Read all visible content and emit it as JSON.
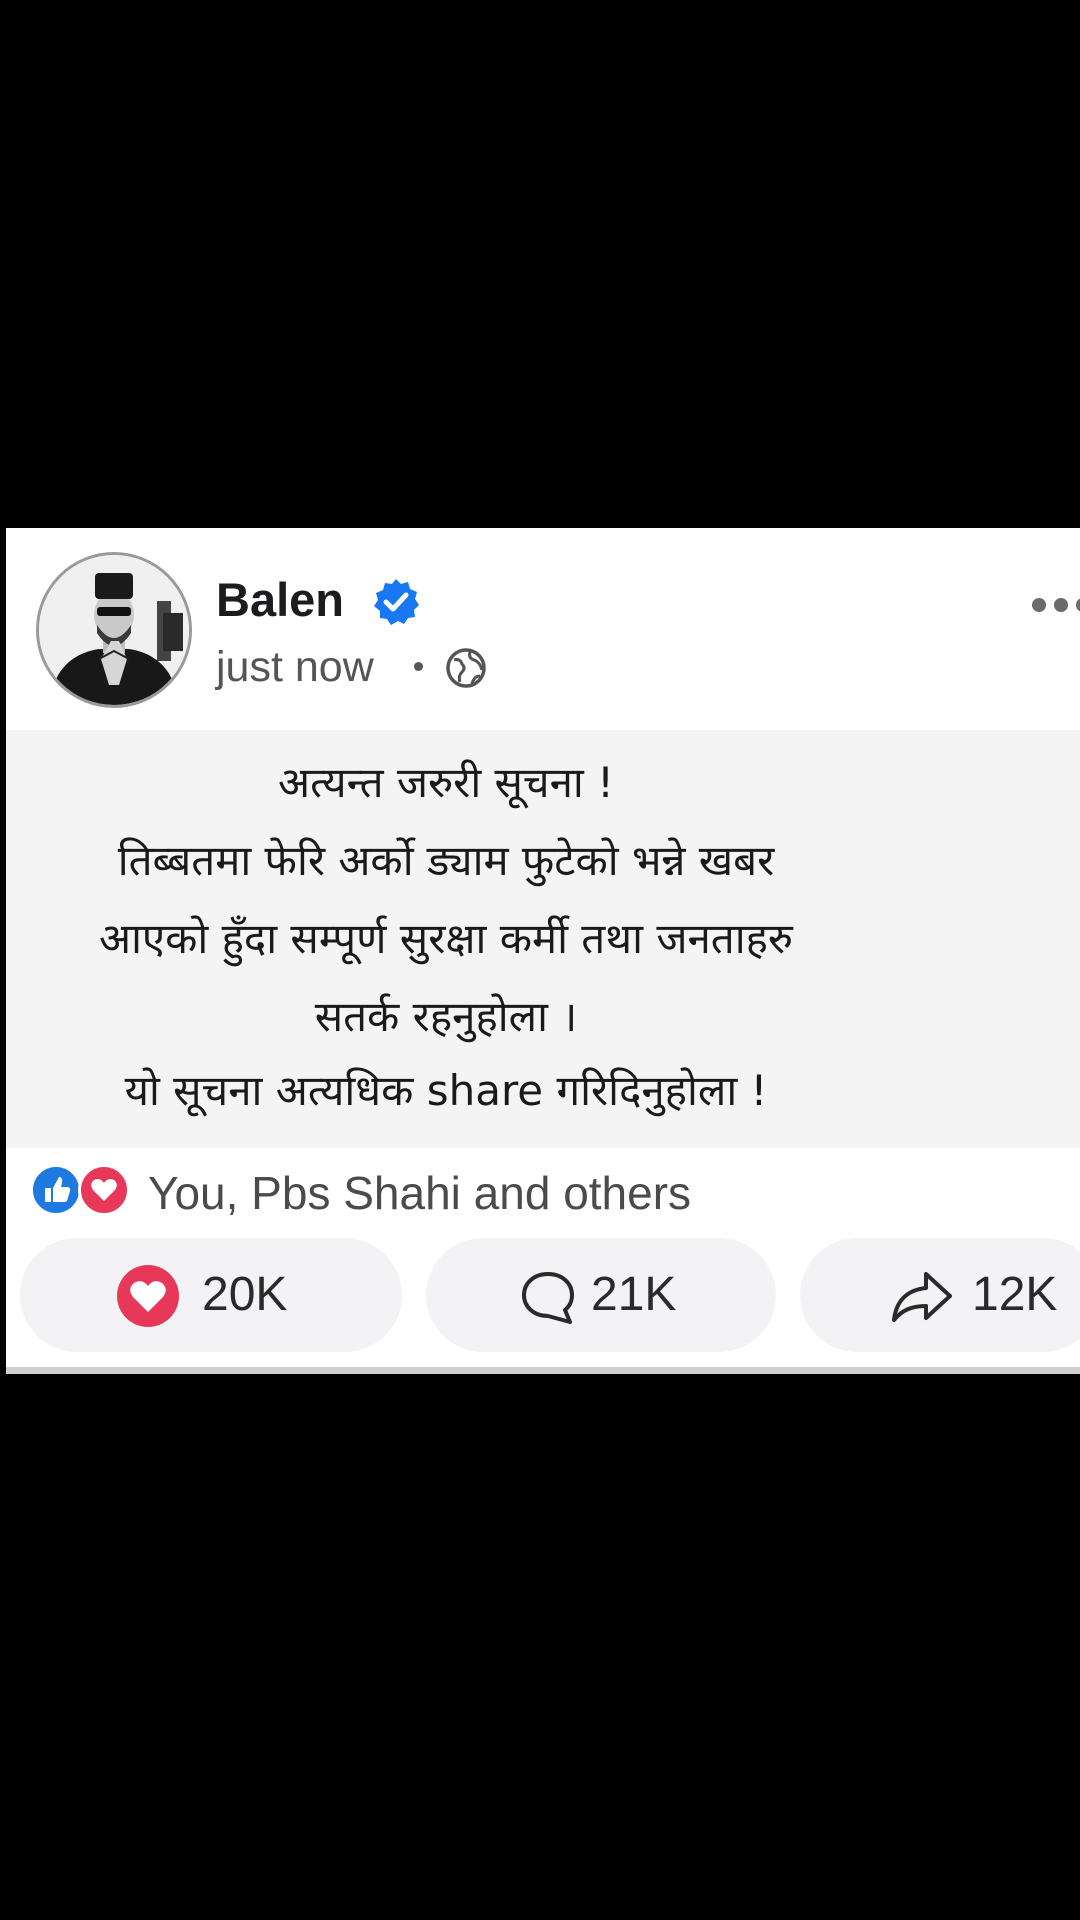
{
  "post": {
    "author": "Balen",
    "time": "just now",
    "content_lines": [
      "अत्यन्त जरुरी सूचना !",
      "तिब्बतमा फेरि अर्को ड्याम फुटेको भन्ने  खबर",
      "आएको हुँदा सम्पूर्ण सुरक्षा कर्मी तथा जनताहरु",
      "सतर्क रहनुहोला ।",
      "यो सूचना अत्यधिक share गरिदिनुहोला !"
    ],
    "reactions_text": "You, Pbs Shahi and others",
    "actions": {
      "like_count": "20K",
      "comment_count": "21K",
      "share_count": "12K"
    }
  },
  "colors": {
    "verified": "#1877f2",
    "like_reaction": "#1f7ae0",
    "love_reaction": "#e8385a",
    "background": "#000000",
    "content_background": "#f4f4f5"
  },
  "icons": [
    "verified-icon",
    "globe-icon",
    "more-icon",
    "like-reaction-icon",
    "love-reaction-icon",
    "heart-icon",
    "comment-icon",
    "share-icon"
  ]
}
